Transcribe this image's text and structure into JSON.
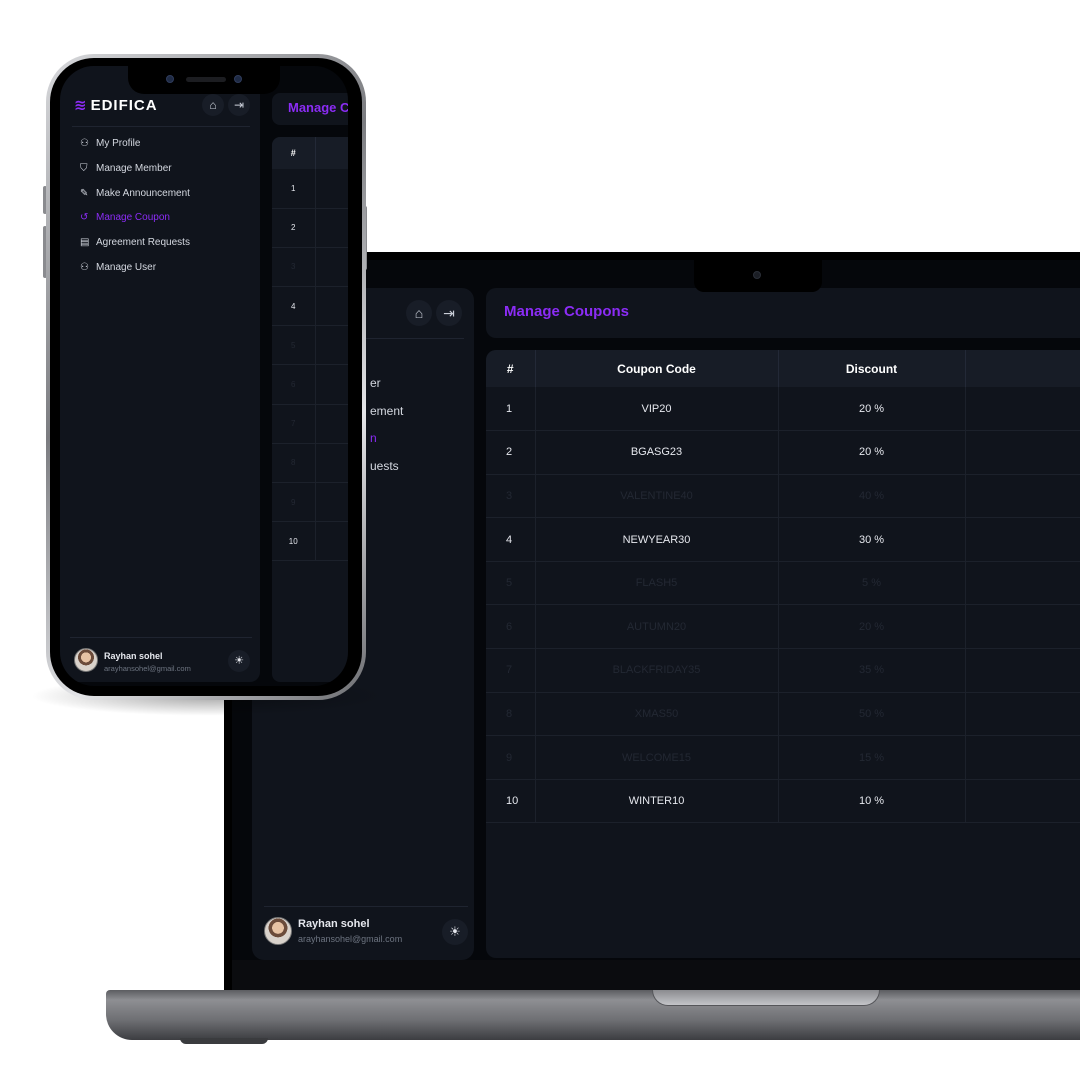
{
  "app": {
    "brand": "EDIFICA",
    "page_title": "Manage Coupons",
    "page_title_mobile_visible": "Manage C"
  },
  "sidebar": {
    "items": [
      {
        "label": "My Profile",
        "icon": "user-icon",
        "active": false
      },
      {
        "label": "Manage Member",
        "icon": "shield-icon",
        "active": false
      },
      {
        "label": "Make Announcement",
        "icon": "edit-icon",
        "active": false
      },
      {
        "label": "Manage Coupon",
        "icon": "history-icon",
        "active": true
      },
      {
        "label": "Agreement Requests",
        "icon": "document-icon",
        "active": false
      },
      {
        "label": "Manage User",
        "icon": "user-cog-icon",
        "active": false
      }
    ],
    "laptop_visible_fragments": [
      "er",
      "ement",
      "n",
      "uests"
    ],
    "home_icon": "⌂",
    "logout_icon": "⇥"
  },
  "user": {
    "name": "Rayhan sohel",
    "email": "arayhansohel@gmail.com",
    "theme_icon": "☀"
  },
  "table": {
    "columns": [
      "#",
      "Coupon Code",
      "Discount"
    ],
    "rows": [
      {
        "num": "1",
        "code": "VIP20",
        "discount": "20 %",
        "dim": false
      },
      {
        "num": "2",
        "code": "BGASG23",
        "discount": "20 %",
        "dim": false
      },
      {
        "num": "3",
        "code": "VALENTINE40",
        "discount": "40 %",
        "dim": true
      },
      {
        "num": "4",
        "code": "NEWYEAR30",
        "discount": "30 %",
        "dim": false
      },
      {
        "num": "5",
        "code": "FLASH5",
        "discount": "5 %",
        "dim": true
      },
      {
        "num": "6",
        "code": "AUTUMN20",
        "discount": "20 %",
        "dim": true
      },
      {
        "num": "7",
        "code": "BLACKFRIDAY35",
        "discount": "35 %",
        "dim": true
      },
      {
        "num": "8",
        "code": "XMAS50",
        "discount": "50 %",
        "dim": true
      },
      {
        "num": "9",
        "code": "WELCOME15",
        "discount": "15 %",
        "dim": true
      },
      {
        "num": "10",
        "code": "WINTER10",
        "discount": "10 %",
        "dim": false
      }
    ]
  },
  "colors": {
    "accent": "#8b2cf5",
    "panel": "#10141c",
    "background": "#05070b"
  }
}
